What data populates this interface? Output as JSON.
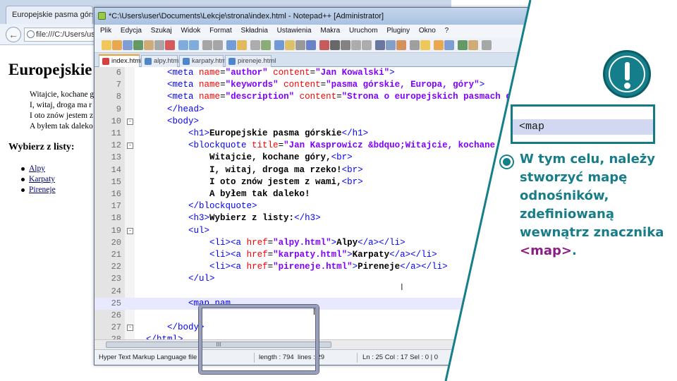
{
  "browser": {
    "tab_title": "Europejskie pasma górskie",
    "back_glyph": "←",
    "address": "file:///C:/Users/user/",
    "page": {
      "heading": "Europejskie",
      "quote_lines": [
        "Witajcie, kochane g",
        "I, witaj, droga ma r",
        "I oto znów jestem z",
        "A byłem tak daleko"
      ],
      "subheading": "Wybierz z listy:",
      "links": [
        "Alpy",
        "Karpaty",
        "Pireneje"
      ]
    }
  },
  "editor": {
    "title": "*C:\\Users\\user\\Documents\\Lekcje\\strona\\index.html - Notepad++ [Administrator]",
    "menu": [
      "Plik",
      "Edycja",
      "Szukaj",
      "Widok",
      "Format",
      "Składnia",
      "Ustawienia",
      "Makra",
      "Uruchom",
      "Pluginy",
      "Okno",
      "?"
    ],
    "tabs": [
      "index.html",
      "alpy.html",
      "karpaty.html",
      "pireneje.html"
    ],
    "active_tab": "index.html",
    "line_numbers": [
      "6",
      "7",
      "8",
      "9",
      "10",
      "11",
      "12",
      "13",
      "14",
      "15",
      "16",
      "17",
      "18",
      "19",
      "20",
      "21",
      "22",
      "23",
      "24",
      "25",
      "26",
      "27",
      "28"
    ],
    "current_line": "25",
    "hscroll_glyph": "III",
    "status": {
      "file_type": "Hyper Text Markup Language file",
      "length": "length : 794",
      "lines": "lines : 29",
      "position": "Ln : 25    Col : 17    Sel : 0 | 0"
    },
    "ibeam_glyph": "I"
  },
  "panel": {
    "icon": "exclamation-icon",
    "code_snippet": "<map",
    "note_text": "W tym celu, należy stworzyć mapę odnośników, zdefiniowaną wewnątrz znacznika",
    "note_keyword": "<map>",
    "note_end": ".",
    "accent_color": "#147f8a",
    "keyword_color": "#8b1e84"
  }
}
